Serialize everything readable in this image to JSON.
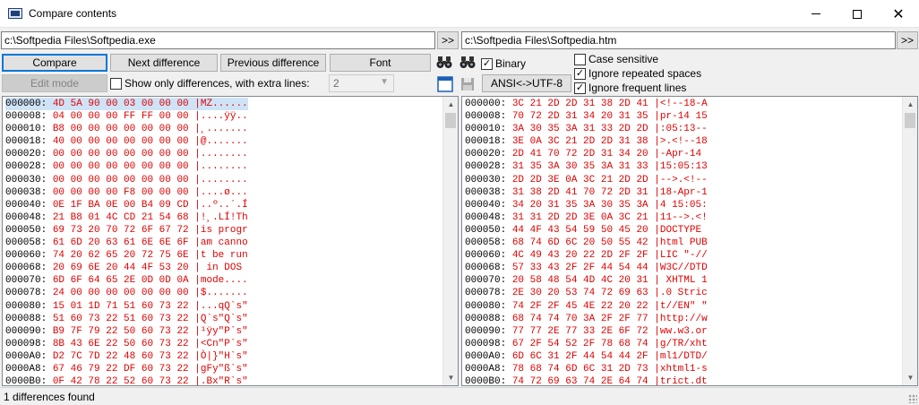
{
  "window": {
    "title": "Compare contents"
  },
  "left": {
    "path": "c:\\Softpedia Files\\Softpedia.exe",
    "browse_label": ">>"
  },
  "right": {
    "path": "c:\\Softpedia Files\\Softpedia.htm",
    "browse_label": ">>"
  },
  "toolbar": {
    "compare": "Compare",
    "next_difference": "Next difference",
    "previous_difference": "Previous difference",
    "font": "Font",
    "edit_mode": "Edit mode",
    "show_only_differences": "Show only differences, with extra lines:",
    "extra_lines_value": "2",
    "binary": "Binary",
    "encoding": "ANSI<->UTF-8"
  },
  "options": {
    "case_sensitive": "Case sensitive",
    "ignore_repeated_spaces": "Ignore repeated spaces",
    "ignore_frequent_lines": "Ignore frequent lines"
  },
  "checks": {
    "binary": true,
    "show_only_differences": false,
    "case_sensitive": false,
    "ignore_repeated_spaces": true,
    "ignore_frequent_lines": true
  },
  "left_lines": [
    [
      "000000:",
      "4D 5A 90 00 03 00 00 00",
      "|MZ......"
    ],
    [
      "000008:",
      "04 00 00 00 FF FF 00 00",
      "|....ÿÿ.."
    ],
    [
      "000010:",
      "B8 00 00 00 00 00 00 00",
      "|¸......."
    ],
    [
      "000018:",
      "40 00 00 00 00 00 00 00",
      "|@......."
    ],
    [
      "000020:",
      "00 00 00 00 00 00 00 00",
      "|........"
    ],
    [
      "000028:",
      "00 00 00 00 00 00 00 00",
      "|........"
    ],
    [
      "000030:",
      "00 00 00 00 00 00 00 00",
      "|........"
    ],
    [
      "000038:",
      "00 00 00 00 F8 00 00 00",
      "|....ø..."
    ],
    [
      "000040:",
      "0E 1F BA 0E 00 B4 09 CD",
      "|..º..´.Í"
    ],
    [
      "000048:",
      "21 B8 01 4C CD 21 54 68",
      "|!¸.LÍ!Th"
    ],
    [
      "000050:",
      "69 73 20 70 72 6F 67 72",
      "|is progr"
    ],
    [
      "000058:",
      "61 6D 20 63 61 6E 6E 6F",
      "|am canno"
    ],
    [
      "000060:",
      "74 20 62 65 20 72 75 6E",
      "|t be run"
    ],
    [
      "000068:",
      "20 69 6E 20 44 4F 53 20",
      "| in DOS "
    ],
    [
      "000070:",
      "6D 6F 64 65 2E 0D 0D 0A",
      "|mode...."
    ],
    [
      "000078:",
      "24 00 00 00 00 00 00 00",
      "|$......."
    ],
    [
      "000080:",
      "15 01 1D 71 51 60 73 22",
      "|...qQ`s\""
    ],
    [
      "000088:",
      "51 60 73 22 51 60 73 22",
      "|Q`s\"Q`s\""
    ],
    [
      "000090:",
      "B9 7F 79 22 50 60 73 22",
      "|¹ÿy\"P`s\""
    ],
    [
      "000098:",
      "8B 43 6E 22 50 60 73 22",
      "|<Cn\"P`s\""
    ],
    [
      "0000A0:",
      "D2 7C 7D 22 48 60 73 22",
      "|Ò|}\"H`s\""
    ],
    [
      "0000A8:",
      "67 46 79 22 DF 60 73 22",
      "|gFy\"ß`s\""
    ],
    [
      "0000B0:",
      "0F 42 78 22 52 60 73 22",
      "|.Bx\"R`s\""
    ]
  ],
  "right_lines": [
    [
      "000000:",
      "3C 21 2D 2D 31 38 2D 41",
      "|<!--18-A"
    ],
    [
      "000008:",
      "70 72 2D 31 34 20 31 35",
      "|pr-14 15"
    ],
    [
      "000010:",
      "3A 30 35 3A 31 33 2D 2D",
      "|:05:13--"
    ],
    [
      "000018:",
      "3E 0A 3C 21 2D 2D 31 38",
      "|>.<!--18"
    ],
    [
      "000020:",
      "2D 41 70 72 2D 31 34 20",
      "|-Apr-14 "
    ],
    [
      "000028:",
      "31 35 3A 30 35 3A 31 33",
      "|15:05:13"
    ],
    [
      "000030:",
      "2D 2D 3E 0A 3C 21 2D 2D",
      "|-->.<!--"
    ],
    [
      "000038:",
      "31 38 2D 41 70 72 2D 31",
      "|18-Apr-1"
    ],
    [
      "000040:",
      "34 20 31 35 3A 30 35 3A",
      "|4 15:05:"
    ],
    [
      "000048:",
      "31 31 2D 2D 3E 0A 3C 21",
      "|11-->.<!"
    ],
    [
      "000050:",
      "44 4F 43 54 59 50 45 20",
      "|DOCTYPE "
    ],
    [
      "000058:",
      "68 74 6D 6C 20 50 55 42",
      "|html PUB"
    ],
    [
      "000060:",
      "4C 49 43 20 22 2D 2F 2F",
      "|LIC \"-//"
    ],
    [
      "000068:",
      "57 33 43 2F 2F 44 54 44",
      "|W3C//DTD"
    ],
    [
      "000070:",
      "20 58 48 54 4D 4C 20 31",
      "| XHTML 1"
    ],
    [
      "000078:",
      "2E 30 20 53 74 72 69 63",
      "|.0 Stric"
    ],
    [
      "000080:",
      "74 2F 2F 45 4E 22 20 22",
      "|t//EN\" \""
    ],
    [
      "000088:",
      "68 74 74 70 3A 2F 2F 77",
      "|http://w"
    ],
    [
      "000090:",
      "77 77 2E 77 33 2E 6F 72",
      "|ww.w3.or"
    ],
    [
      "000098:",
      "67 2F 54 52 2F 78 68 74",
      "|g/TR/xht"
    ],
    [
      "0000A0:",
      "6D 6C 31 2F 44 54 44 2F",
      "|ml1/DTD/"
    ],
    [
      "0000A8:",
      "78 68 74 6D 6C 31 2D 73",
      "|xhtml1-s"
    ],
    [
      "0000B0:",
      "74 72 69 63 74 2E 64 74",
      "|trict.dt"
    ]
  ],
  "status": "1 differences found"
}
